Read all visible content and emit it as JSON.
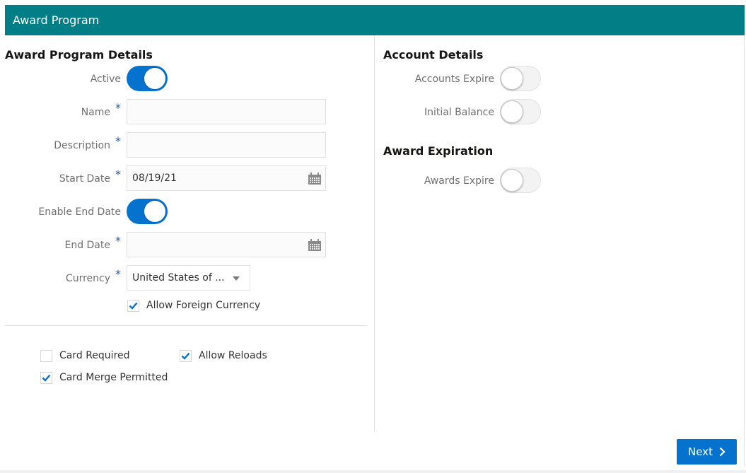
{
  "header": {
    "title": "Award Program"
  },
  "colors": {
    "header_bg": "#017e86",
    "accent": "#0572ce"
  },
  "award_program_details": {
    "title": "Award Program Details",
    "active": {
      "label": "Active",
      "on": true
    },
    "name": {
      "label": "Name",
      "required": "*",
      "value": ""
    },
    "description": {
      "label": "Description",
      "required": "*",
      "value": ""
    },
    "start_date": {
      "label": "Start Date",
      "required": "*",
      "value": "08/19/21",
      "icon": "calendar-icon"
    },
    "enable_end_date": {
      "label": "Enable End Date",
      "on": true
    },
    "end_date": {
      "label": "End Date",
      "required": "*",
      "value": "",
      "icon": "calendar-icon"
    },
    "currency": {
      "label": "Currency",
      "required": "*",
      "value": "United States of ...",
      "icon": "chevron-down-icon"
    },
    "allow_foreign_currency": {
      "label": "Allow Foreign Currency",
      "checked": true
    }
  },
  "options": {
    "card_required": {
      "label": "Card Required",
      "checked": false
    },
    "allow_reloads": {
      "label": "Allow Reloads",
      "checked": true
    },
    "card_merge_permitted": {
      "label": "Card Merge Permitted",
      "checked": true
    }
  },
  "account_details": {
    "title": "Account Details",
    "accounts_expire": {
      "label": "Accounts Expire",
      "on": false
    },
    "initial_balance": {
      "label": "Initial Balance",
      "on": false
    }
  },
  "award_expiration": {
    "title": "Award Expiration",
    "awards_expire": {
      "label": "Awards Expire",
      "on": false
    }
  },
  "footer": {
    "next_label": "Next",
    "next_icon": "chevron-right-icon"
  }
}
